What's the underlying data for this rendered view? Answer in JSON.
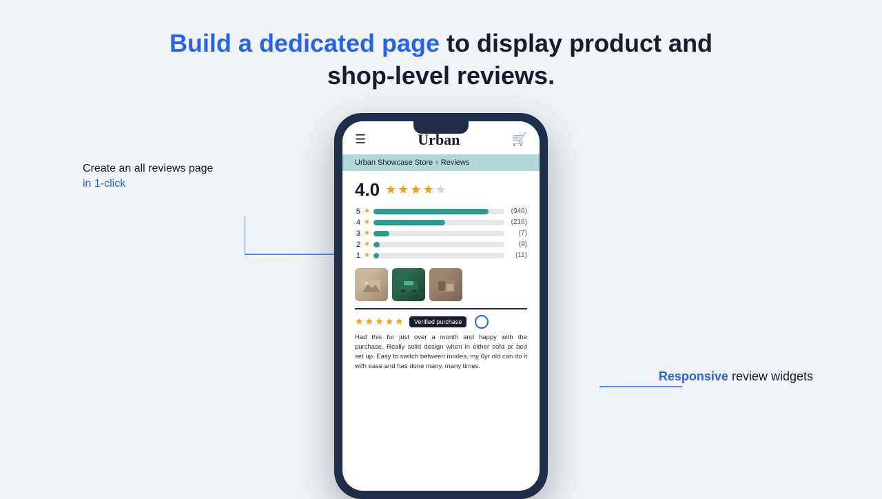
{
  "header": {
    "title_part1": "Build a dedicated page",
    "title_part2": " to display product and",
    "title_line2": "shop-level reviews."
  },
  "left_annotation": {
    "line1": "Create an all reviews page",
    "line2": "in 1-click"
  },
  "right_annotation": {
    "line1": "Responsive",
    "line2": " review widgets"
  },
  "phone": {
    "store_name": "Urban",
    "breadcrumb": {
      "store": "Urban Showcase Store",
      "separator": "›",
      "page": "Reviews"
    },
    "overall_rating": {
      "number": "4.0",
      "stars_filled": 4,
      "stars_empty": 1
    },
    "rating_bars": [
      {
        "label": "5",
        "fill_pct": 88,
        "count": "(946)"
      },
      {
        "label": "4",
        "fill_pct": 55,
        "count": "(216)"
      },
      {
        "label": "3",
        "fill_pct": 12,
        "count": "(7)"
      },
      {
        "label": "2",
        "fill_pct": 5,
        "count": "(9)"
      },
      {
        "label": "1",
        "fill_pct": 4,
        "count": "(11)"
      }
    ],
    "review": {
      "stars": 5,
      "verified_label": "Verified purchase",
      "text": "Had this for just over a month and happy with the purchase. Really solid design when in either sofa or bed set up. Easy to switch between modes, my 6yr old can do it with ease and has done many, many times."
    }
  }
}
